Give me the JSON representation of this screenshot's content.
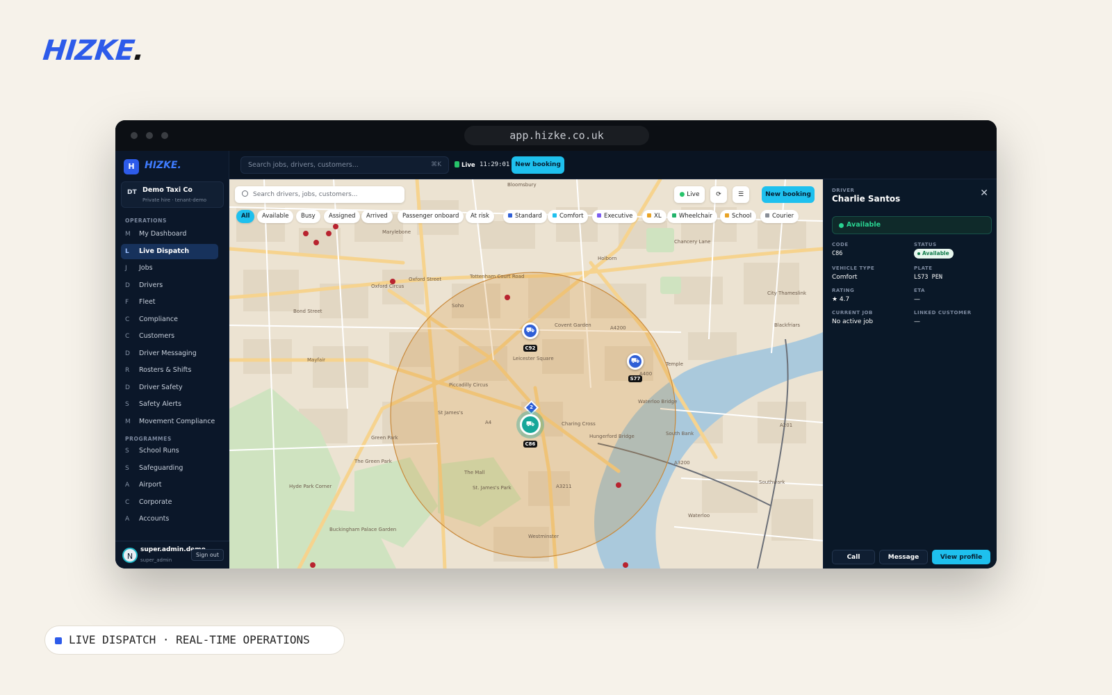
{
  "brand": {
    "name": "HIZKE",
    "dot": "."
  },
  "browser": {
    "url": "app.hizke.co.uk"
  },
  "sidebar": {
    "logo_letter": "H",
    "logo_text": "HIZKE.",
    "org": {
      "initials": "DT",
      "name": "Demo Taxi Co",
      "sub": "Private hire · tenant-demo"
    },
    "operations_label": "OPERATIONS",
    "operations": [
      {
        "icon": "M",
        "label": "My Dashboard"
      },
      {
        "icon": "L",
        "label": "Live Dispatch",
        "active": true
      },
      {
        "icon": "J",
        "label": "Jobs"
      },
      {
        "icon": "D",
        "label": "Drivers"
      },
      {
        "icon": "F",
        "label": "Fleet"
      },
      {
        "icon": "C",
        "label": "Compliance"
      },
      {
        "icon": "C",
        "label": "Customers"
      },
      {
        "icon": "D",
        "label": "Driver Messaging"
      },
      {
        "icon": "R",
        "label": "Rosters & Shifts"
      },
      {
        "icon": "D",
        "label": "Driver Safety"
      },
      {
        "icon": "S",
        "label": "Safety Alerts"
      },
      {
        "icon": "M",
        "label": "Movement Compliance"
      }
    ],
    "programmes_label": "PROGRAMMES",
    "programmes": [
      {
        "icon": "S",
        "label": "School Runs"
      },
      {
        "icon": "S",
        "label": "Safeguarding"
      },
      {
        "icon": "A",
        "label": "Airport"
      },
      {
        "icon": "C",
        "label": "Corporate"
      },
      {
        "icon": "A",
        "label": "Accounts"
      }
    ],
    "user": {
      "avatar": "N",
      "name": "super.admin.demo",
      "role": "super_admin",
      "sign_out": "Sign out"
    }
  },
  "topbar": {
    "search_placeholder": "Search jobs, drivers, customers...",
    "shortcut": "⌘K",
    "live": "Live",
    "clock": "11:29:01",
    "new_booking": "New booking"
  },
  "map": {
    "search_placeholder": "Search drivers, jobs, customers...",
    "live": "Live",
    "new_booking": "New booking",
    "chips": [
      {
        "label": "All",
        "selected": true
      },
      {
        "label": "Available"
      },
      {
        "label": "Busy"
      },
      {
        "label": "Assigned"
      },
      {
        "label": "Arrived"
      },
      {
        "label": "Passenger onboard"
      },
      {
        "label": "At risk"
      },
      {
        "label": "Standard",
        "color": "#2f5fd6"
      },
      {
        "label": "Comfort",
        "color": "#1ec0ee"
      },
      {
        "label": "Executive",
        "color": "#7b5cf0"
      },
      {
        "label": "XL",
        "color": "#e8a325"
      },
      {
        "label": "Wheelchair",
        "color": "#21b36b"
      },
      {
        "label": "School",
        "color": "#e8a325"
      },
      {
        "label": "Courier",
        "color": "#8a8f98"
      }
    ],
    "markers": [
      {
        "code": "C92"
      },
      {
        "code": "S77"
      },
      {
        "code": "C86",
        "selected": true
      }
    ],
    "cluster": "2",
    "labels": [
      "Bloomsbury",
      "Soho",
      "Covent Garden",
      "Mayfair",
      "St James's",
      "Piccadilly Circus",
      "Oxford Circus",
      "Leicester Square",
      "Charing Cross",
      "Waterloo Bridge",
      "Hungerford Bridge",
      "Green Park",
      "St. James's Park",
      "The Green Park",
      "Hyde Park Corner",
      "Buckingham Palace Garden",
      "South Bank",
      "Waterloo",
      "Temple",
      "Blackfriars",
      "Westminster",
      "Holborn",
      "Oxford Street",
      "Bond Street",
      "The Mall",
      "A4",
      "A400",
      "A3211",
      "A4200",
      "A3200",
      "A201",
      "Tottenham Court Road",
      "Marylebone",
      "Chancery Lane",
      "City Thameslink",
      "Southwark"
    ]
  },
  "panel": {
    "section_label": "DRIVER",
    "name": "Charlie Santos",
    "status_bar": "Available",
    "fields": {
      "code_label": "CODE",
      "code": "C86",
      "status_label": "STATUS",
      "status": "Available",
      "vehicle_type_label": "VEHICLE TYPE",
      "vehicle_type": "Comfort",
      "plate_label": "PLATE",
      "plate": "LS73 PEN",
      "rating_label": "RATING",
      "rating": "★ 4.7",
      "eta_label": "ETA",
      "eta": "—",
      "current_job_label": "CURRENT JOB",
      "current_job": "No active job",
      "linked_customer_label": "LINKED CUSTOMER",
      "linked_customer": "—"
    },
    "buttons": {
      "call": "Call",
      "message": "Message",
      "view_profile": "View profile"
    }
  },
  "caption": "LIVE DISPATCH · REAL-TIME OPERATIONS",
  "colors": {
    "accent": "#1ec0ee",
    "brand": "#2d5bea",
    "available": "#29d391",
    "sidebar_bg": "#0b1729"
  }
}
